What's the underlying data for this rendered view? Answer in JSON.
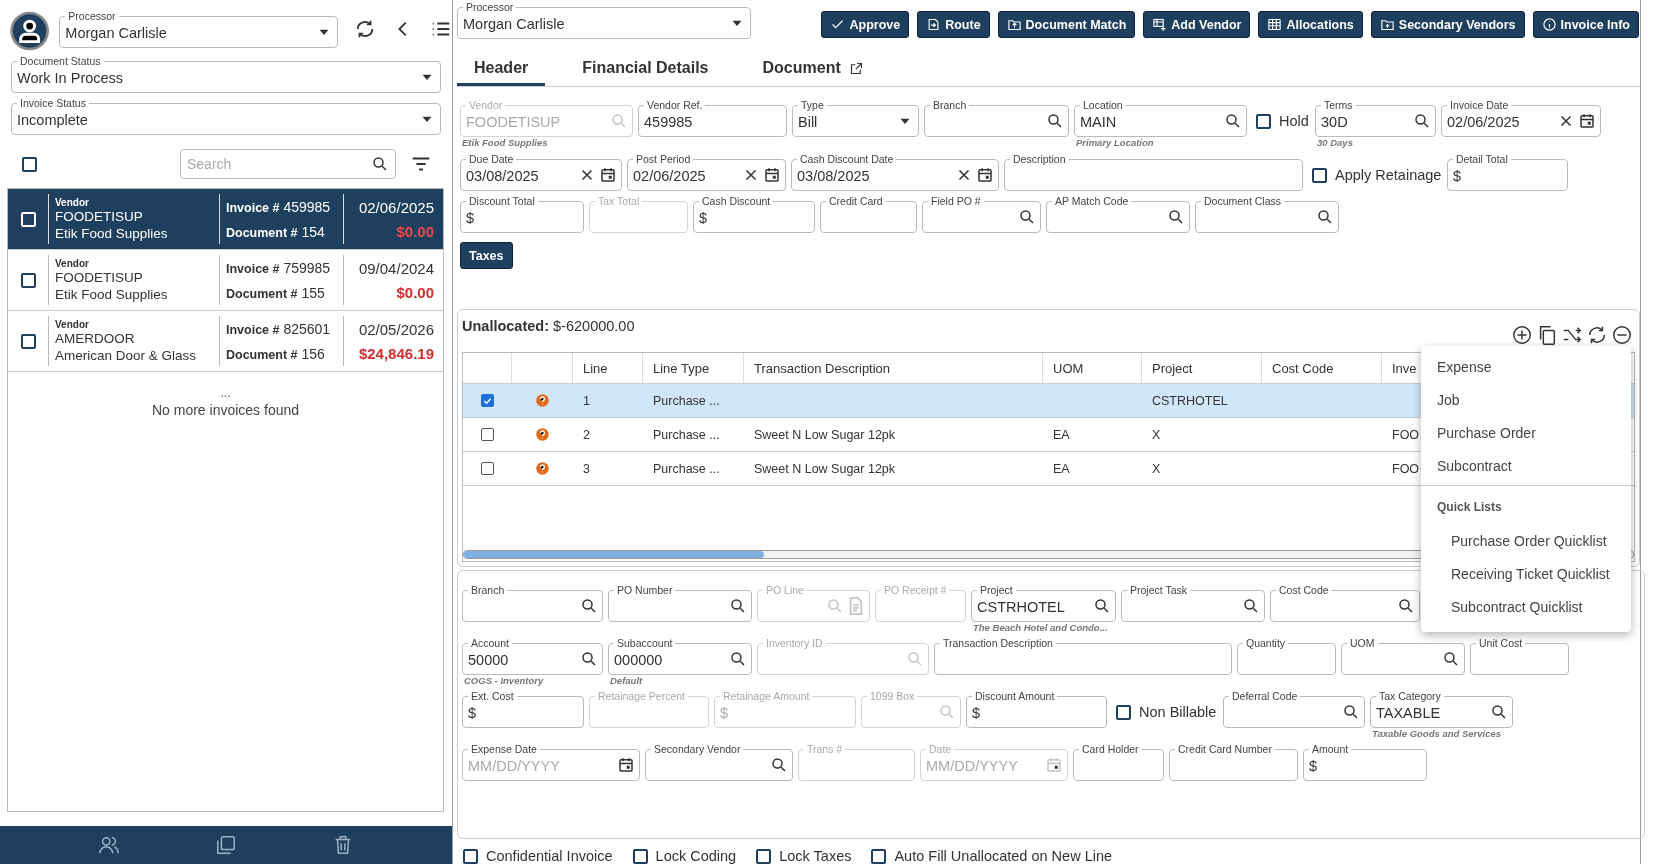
{
  "sidebar": {
    "processor": {
      "label": "Processor",
      "value": "Morgan Carlisle"
    },
    "document_status": {
      "label": "Document Status",
      "value": "Work In Process"
    },
    "invoice_status": {
      "label": "Invoice Status",
      "value": "Incomplete"
    },
    "select_all": {
      "checked": false
    },
    "search": {
      "placeholder": "Search"
    },
    "invoices": [
      {
        "vendor_label": "Vendor",
        "vendor_code": "FOODETISUP",
        "vendor_name": "Etik Food Supplies",
        "invoice_label": "Invoice #",
        "invoice_no": "459985",
        "document_label": "Document #",
        "document_no": "154",
        "date": "02/06/2025",
        "amount": "$0.00",
        "checked": false,
        "selected": true
      },
      {
        "vendor_label": "Vendor",
        "vendor_code": "FOODETISUP",
        "vendor_name": "Etik Food Supplies",
        "invoice_label": "Invoice #",
        "invoice_no": "759985",
        "document_label": "Document #",
        "document_no": "155",
        "date": "09/04/2024",
        "amount": "$0.00",
        "checked": false,
        "selected": false
      },
      {
        "vendor_label": "Vendor",
        "vendor_code": "AMERDOOR",
        "vendor_name": "American Door & Glass",
        "invoice_label": "Invoice #",
        "invoice_no": "825601",
        "document_label": "Document #",
        "document_no": "156",
        "date": "02/05/2026",
        "amount": "$24,846.19",
        "checked": false,
        "selected": false
      }
    ],
    "more": "...",
    "end_text": "No more invoices found"
  },
  "processor": {
    "label": "Processor",
    "value": "Morgan Carlisle"
  },
  "actions": [
    {
      "label": "Approve"
    },
    {
      "label": "Route"
    },
    {
      "label": "Document Match"
    },
    {
      "label": "Add Vendor"
    },
    {
      "label": "Allocations"
    },
    {
      "label": "Secondary Vendors"
    },
    {
      "label": "Invoice Info"
    }
  ],
  "tabs": [
    {
      "label": "Header",
      "selected": true
    },
    {
      "label": "Financial Details",
      "selected": false
    },
    {
      "label": "Document",
      "selected": false
    }
  ],
  "header_form": {
    "fields": [
      {
        "kind": "lookup",
        "label": "Vendor",
        "value": "FOODETISUP",
        "disabled": true,
        "hint": "Etik Food Supplies"
      },
      {
        "kind": "text",
        "label": "Vendor Ref.",
        "value": "459985",
        "disabled": false
      },
      {
        "kind": "select",
        "label": "Type",
        "value": "Bill",
        "disabled": false
      },
      {
        "kind": "lookup",
        "label": "Branch",
        "disabled": false
      },
      {
        "kind": "lookup",
        "label": "Location",
        "value": "MAIN",
        "disabled": false,
        "hint": "Primary Location"
      },
      {
        "kind": "checkbox",
        "label": "Hold",
        "checked": false
      },
      {
        "kind": "lookup",
        "label": "Terms",
        "value": "30D",
        "disabled": false,
        "hint": "30 Days"
      },
      {
        "kind": "date",
        "label": "Invoice Date",
        "value": "02/06/2025",
        "disabled": false
      },
      {
        "kind": "date",
        "label": "Due Date",
        "value": "03/08/2025",
        "disabled": false
      },
      {
        "kind": "date",
        "label": "Post Period",
        "value": "02/06/2025",
        "disabled": false
      },
      {
        "kind": "date",
        "label": "Cash Discount Date",
        "value": "03/08/2025",
        "disabled": false
      },
      {
        "kind": "text",
        "label": "Description",
        "disabled": false
      },
      {
        "kind": "checkbox",
        "label": "Apply Retainage",
        "checked": false
      },
      {
        "kind": "text",
        "label": "Detail Total",
        "value": "$",
        "disabled": false
      },
      {
        "kind": "text",
        "label": "Discount Total",
        "value": "$",
        "disabled": false
      },
      {
        "kind": "text",
        "label": "Tax Total",
        "disabled": true
      },
      {
        "kind": "text",
        "label": "Cash Discount",
        "value": "$",
        "disabled": false
      },
      {
        "kind": "text",
        "label": "Credit Card",
        "disabled": false
      },
      {
        "kind": "lookup",
        "label": "Field PO #",
        "disabled": false
      },
      {
        "kind": "lookup",
        "label": "AP Match Code",
        "disabled": false
      },
      {
        "kind": "lookup",
        "label": "Document Class",
        "disabled": false
      }
    ]
  },
  "taxes_button": "Taxes",
  "lines": {
    "unallocated_label": "Unallocated:",
    "unallocated_value": "$-620000.00",
    "columns": [
      {
        "label": "Line"
      },
      {
        "label": "Line Type"
      },
      {
        "label": "Transaction Description"
      },
      {
        "label": "UOM"
      },
      {
        "label": "Project"
      },
      {
        "label": "Cost Code"
      },
      {
        "label": "Inve"
      }
    ],
    "rows": [
      {
        "checked": true,
        "selected": true,
        "line": "1",
        "line_type": "Purchase ...",
        "project": "CSTRHOTEL"
      },
      {
        "checked": false,
        "selected": false,
        "line": "2",
        "line_type": "Purchase ...",
        "description": "Sweet N Low Sugar 12pk",
        "uom": "EA",
        "project": "X",
        "inventory": "FOO"
      },
      {
        "checked": false,
        "selected": false,
        "line": "3",
        "line_type": "Purchase ...",
        "description": "Sweet N Low Sugar 12pk",
        "uom": "EA",
        "project": "X",
        "inventory": "FOO"
      }
    ]
  },
  "line_type_menu": {
    "items": [
      {
        "label": "Expense"
      },
      {
        "label": "Job"
      },
      {
        "label": "Purchase Order"
      },
      {
        "label": "Subcontract"
      }
    ],
    "section": "Quick Lists",
    "quick_items": [
      {
        "label": "Purchase Order Quicklist"
      },
      {
        "label": "Receiving Ticket Quicklist"
      },
      {
        "label": "Subcontract Quicklist"
      }
    ]
  },
  "detail_form": {
    "fields": [
      {
        "kind": "lookup",
        "label": "Branch",
        "disabled": false
      },
      {
        "kind": "lookup",
        "label": "PO Number",
        "disabled": false
      },
      {
        "kind": "lookup_doc",
        "label": "PO Line",
        "disabled": true
      },
      {
        "kind": "text",
        "label": "PO Receipt #",
        "disabled": true
      },
      {
        "kind": "lookup",
        "label": "Project",
        "value": "CSTRHOTEL",
        "disabled": false,
        "hint": "The Beach Hotel and Condo..."
      },
      {
        "kind": "lookup",
        "label": "Project Task",
        "disabled": false
      },
      {
        "kind": "lookup",
        "label": "Cost Code",
        "disabled": false
      },
      {
        "kind": "lookup",
        "label": "Account",
        "value": "50000",
        "disabled": false,
        "hint": "COGS - Inventory"
      },
      {
        "kind": "lookup",
        "label": "Subaccount",
        "value": "000000",
        "disabled": false,
        "hint": "Default"
      },
      {
        "kind": "lookup",
        "label": "Inventory ID",
        "disabled": true
      },
      {
        "kind": "text",
        "label": "Transaction Description",
        "disabled": false
      },
      {
        "kind": "text",
        "label": "Quantity",
        "disabled": false
      },
      {
        "kind": "lookup",
        "label": "UOM",
        "disabled": false
      },
      {
        "kind": "text",
        "label": "Unit Cost",
        "disabled": false
      },
      {
        "kind": "text",
        "label": "Ext. Cost",
        "value": "$",
        "disabled": false
      },
      {
        "kind": "text",
        "label": "Retainage Percent",
        "disabled": true
      },
      {
        "kind": "text",
        "label": "Retainage Amount",
        "value": "$",
        "disabled": true
      },
      {
        "kind": "lookup",
        "label": "1099 Box",
        "disabled": true
      },
      {
        "kind": "text",
        "label": "Discount Amount",
        "value": "$",
        "disabled": false
      },
      {
        "kind": "checkbox",
        "label": "Non Billable",
        "checked": false
      },
      {
        "kind": "lookup",
        "label": "Deferral Code",
        "disabled": false
      },
      {
        "kind": "lookup",
        "label": "Tax Category",
        "value": "TAXABLE",
        "disabled": false,
        "hint": "Taxable Goods and Services"
      },
      {
        "kind": "date",
        "label": "Expense Date",
        "placeholder": "MM/DD/YYYY",
        "disabled": false
      },
      {
        "kind": "lookup",
        "label": "Secondary Vendor",
        "disabled": false
      },
      {
        "kind": "text",
        "label": "Trans #",
        "disabled": true
      },
      {
        "kind": "date",
        "label": "Date",
        "placeholder": "MM/DD/YYYY",
        "disabled": true
      },
      {
        "kind": "text",
        "label": "Card Holder",
        "disabled": false
      },
      {
        "kind": "text",
        "label": "Credit Card Number",
        "disabled": false
      },
      {
        "kind": "text",
        "label": "Amount",
        "value": "$",
        "disabled": false
      }
    ]
  },
  "options": [
    {
      "label": "Confidential Invoice",
      "checked": false
    },
    {
      "label": "Lock Coding",
      "checked": false
    },
    {
      "label": "Lock Taxes",
      "checked": false
    },
    {
      "label": "Auto Fill Unallocated on New Line",
      "checked": false
    }
  ]
}
